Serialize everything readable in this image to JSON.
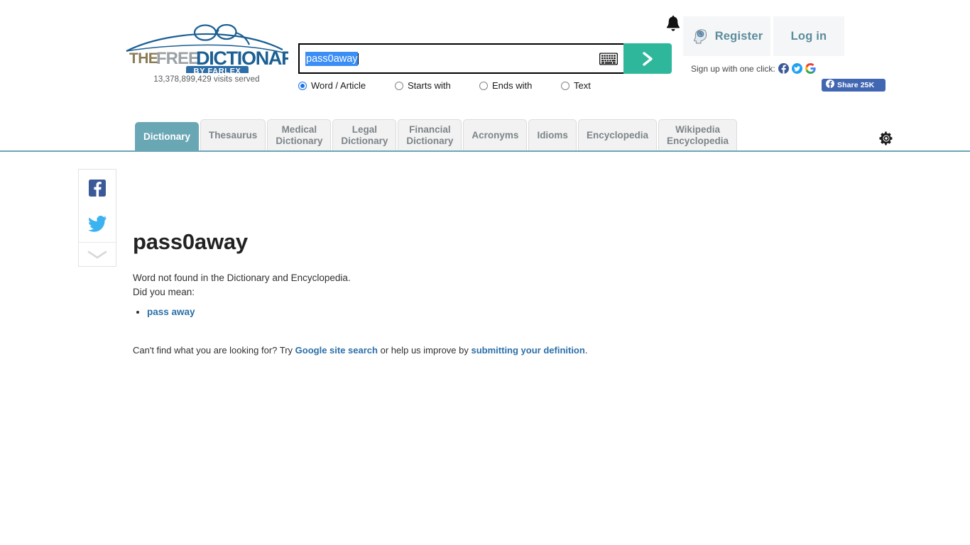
{
  "site": {
    "logo_the": "THE",
    "logo_free": "FREE",
    "logo_dictionary": "DICTIONARY",
    "logo_byline": "BY FARLEX",
    "visits": "13,378,899,429 visits served"
  },
  "search": {
    "value": "pass0away",
    "placeholder": "",
    "keyboard_icon": "keyboard-icon",
    "submit_icon": "chevron-right-icon",
    "submit_color": "#2fb79c",
    "options": [
      {
        "label": "Word / Article",
        "checked": true
      },
      {
        "label": "Starts with",
        "checked": false
      },
      {
        "label": "Ends with",
        "checked": false
      },
      {
        "label": "Text",
        "checked": false
      }
    ]
  },
  "account": {
    "bell_icon": "bell-icon",
    "register_label": "Register",
    "register_icon": "brain-head-icon",
    "login_label": "Log in",
    "oneclick_label": "Sign up with one click:",
    "oneclick_icons": [
      "facebook-icon",
      "twitter-icon",
      "google-icon"
    ],
    "share_label": "Share 25K",
    "share_icon": "facebook-icon",
    "share_color": "#4267b2"
  },
  "tabs": [
    {
      "label": "Dictionary",
      "active": true
    },
    {
      "label": "Thesaurus",
      "active": false
    },
    {
      "label": "Medical\nDictionary",
      "active": false
    },
    {
      "label": "Legal\nDictionary",
      "active": false
    },
    {
      "label": "Financial\nDictionary",
      "active": false
    },
    {
      "label": "Acronyms",
      "active": false
    },
    {
      "label": "Idioms",
      "active": false
    },
    {
      "label": "Encyclopedia",
      "active": false
    },
    {
      "label": "Wikipedia\nEncyclopedia",
      "active": false
    }
  ],
  "toolbar": {
    "settings_icon": "gear-icon"
  },
  "share_rail": {
    "items": [
      "facebook-icon",
      "twitter-icon"
    ],
    "collapse_icon": "chevron-down-icon"
  },
  "main": {
    "headword": "pass0away",
    "not_found": "Word not found in the Dictionary and Encyclopedia.",
    "did_you_mean": "Did you mean:",
    "suggestions": [
      "pass away"
    ],
    "footer_prefix": "Can't find what you are looking for? Try ",
    "footer_link1": "Google site search",
    "footer_middle": " or help us improve by ",
    "footer_link2": "submitting your definition",
    "footer_suffix": "."
  },
  "colors": {
    "accent_teal": "#6aa7b5",
    "button_green": "#2fb79c",
    "link_blue": "#2b6fa8",
    "selection_blue": "#3b8ef5"
  }
}
